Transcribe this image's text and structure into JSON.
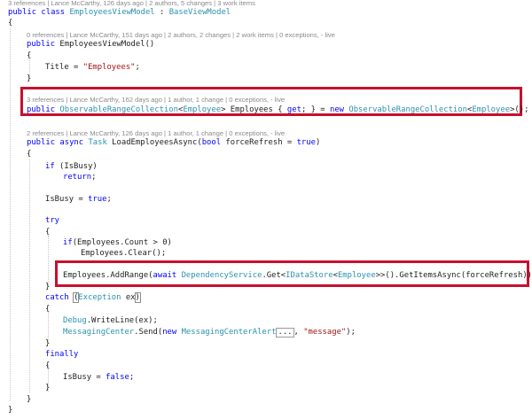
{
  "codelens": {
    "class": "3 references | Lance McCarthy, 126 days ago | 2 authors, 5 changes | 3 work items",
    "ctor": "0 references | Lance McCarthy, 151 days ago | 2 authors, 2 changes | 2 work items | 0 exceptions, - live",
    "property": "3 references | Lance McCarthy, 162 days ago | 1 author, 1 change | 0 exceptions, - live",
    "method": "2 references | Lance McCarthy, 126 days ago | 1 author, 1 change | 0 exceptions, - live"
  },
  "code": {
    "class_decl": [
      "public",
      " ",
      "class",
      " ",
      "EmployeesViewModel",
      " : ",
      "BaseViewModel"
    ],
    "brace_open": "{",
    "brace_close": "}",
    "ctor_decl": [
      "public",
      " ",
      "EmployeesViewModel",
      "()"
    ],
    "title_assign": [
      "Title = ",
      "\"Employees\"",
      ";"
    ],
    "prop_decl": [
      "public",
      " ",
      "ObservableRangeCollection",
      "<",
      "Employee",
      "> Employees { ",
      "get",
      "; } = ",
      "new",
      " ",
      "ObservableRangeCollection",
      "<",
      "Employee",
      ">();"
    ],
    "method_decl": [
      "public",
      " ",
      "async",
      " ",
      "Task",
      " LoadEmployeesAsync(",
      "bool",
      " forceRefresh = ",
      "true",
      ")"
    ],
    "if_busy": [
      "if",
      " (IsBusy)"
    ],
    "return_stmt": [
      "return",
      ";"
    ],
    "isbusy_true": [
      "IsBusy = ",
      "true",
      ";"
    ],
    "try_kw": "try",
    "if_count": [
      "if",
      "(Employees.Count > 0)"
    ],
    "clear_stmt": "Employees.Clear();",
    "addrange": [
      "Employees.AddRange(",
      "await",
      " ",
      "DependencyService",
      ".Get<",
      "IDataStore",
      "<",
      "Employee",
      ">>().GetItemsAsync(forceRefresh));"
    ],
    "catch_line": [
      "catch",
      " ",
      "(",
      "Exception",
      " ex",
      ")"
    ],
    "debug_line": [
      "Debug",
      ".WriteLine(ex);"
    ],
    "messaging_line": [
      "MessagingCenter",
      ".Send(",
      "new",
      " ",
      "MessagingCenterAlert",
      "...",
      ", ",
      "\"message\"",
      ");"
    ],
    "finally_kw": "finally",
    "isbusy_false": [
      "IsBusy = ",
      "false",
      ";"
    ]
  },
  "colors": {
    "keyword": "#0000ff",
    "type": "#2b91af",
    "string": "#a31515",
    "codelens": "#8a8a8a",
    "highlight_box": "#c8102e"
  }
}
